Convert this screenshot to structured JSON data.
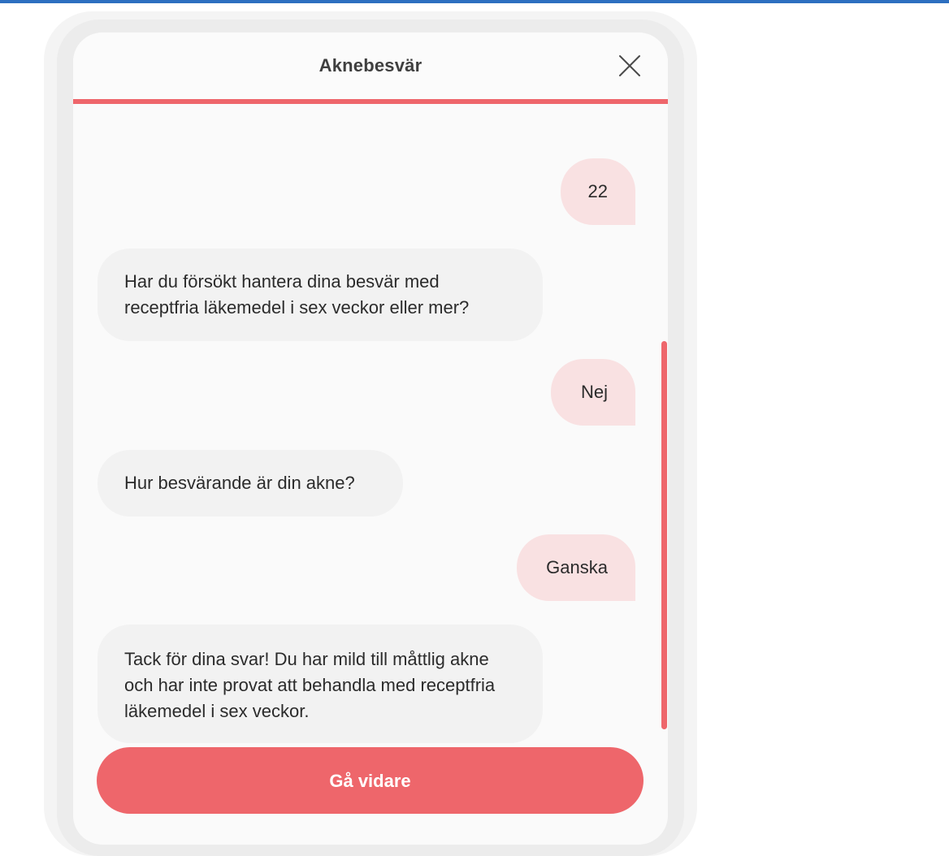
{
  "colors": {
    "accent": "#ee666b",
    "user_bubble": "#f9e1e2",
    "bot_bubble": "#f2f2f2",
    "top_rule": "#2d6fc0"
  },
  "header": {
    "title": "Aknebesvär",
    "close_icon": "close-icon"
  },
  "messages": [
    {
      "sender": "user",
      "text": "22"
    },
    {
      "sender": "bot",
      "text": "Har du försökt hantera dina besvär med receptfria läkemedel i sex veckor eller mer?"
    },
    {
      "sender": "user",
      "text": "Nej"
    },
    {
      "sender": "bot",
      "text": "Hur besvärande är din akne?"
    },
    {
      "sender": "user",
      "text": "Ganska"
    },
    {
      "sender": "bot",
      "text": "Tack för dina svar! Du har mild till måttlig akne och har inte provat att behandla med receptfria läkemedel i sex veckor."
    }
  ],
  "footer": {
    "continue_label": "Gå vidare"
  }
}
